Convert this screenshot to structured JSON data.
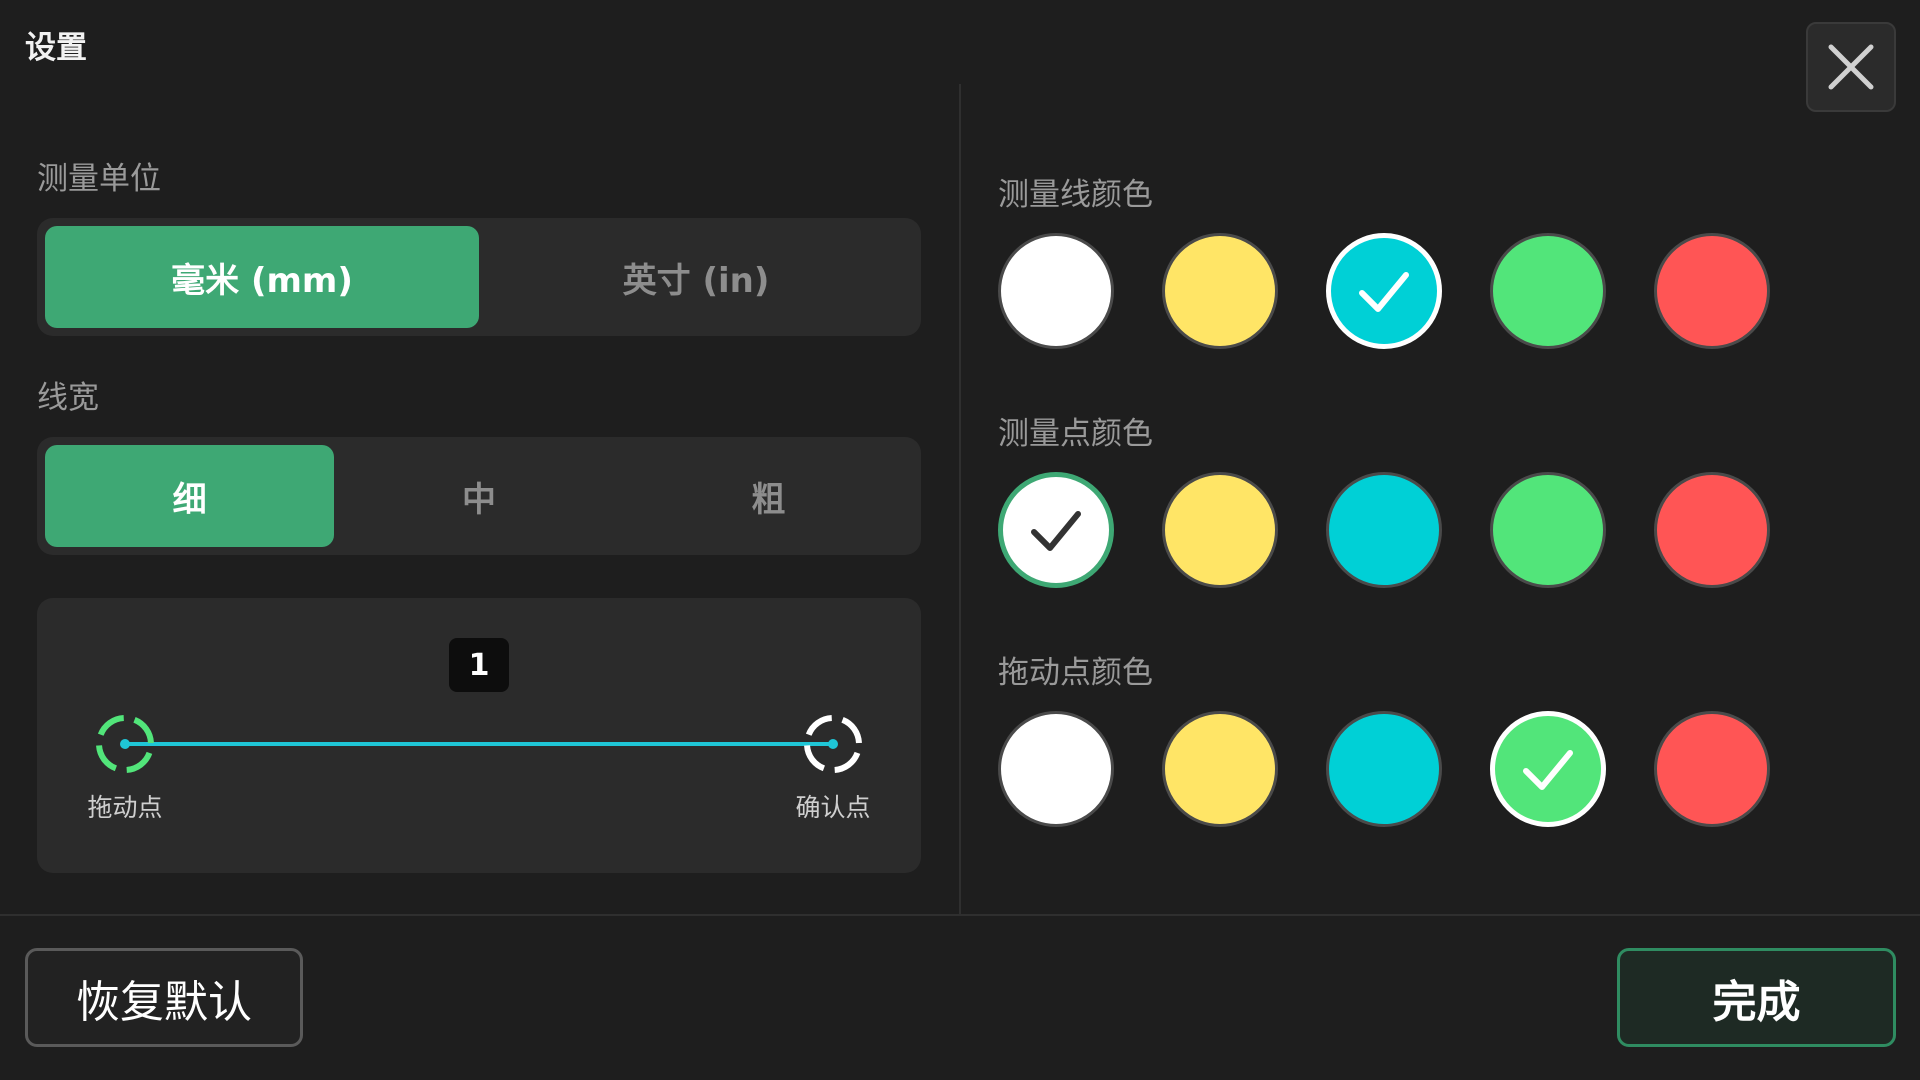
{
  "header": {
    "title": "设置",
    "close_icon": "close-icon"
  },
  "units": {
    "label": "测量单位",
    "options": [
      "毫米 (mm)",
      "英寸 (in)"
    ],
    "selected": "毫米 (mm)"
  },
  "line_width": {
    "label": "线宽",
    "options": [
      "细",
      "中",
      "粗"
    ],
    "selected": "细"
  },
  "preview": {
    "value": "1",
    "start_label": "拖动点",
    "end_label": "确认点"
  },
  "colors": {
    "palette": [
      "#ffffff",
      "#ffe566",
      "#00d0d6",
      "#52e57a",
      "#ff5555"
    ],
    "line_color": {
      "label": "测量线颜色",
      "selected": "#00d0d6"
    },
    "point_color": {
      "label": "测量点颜色",
      "selected": "#ffffff"
    },
    "drag_color": {
      "label": "拖动点颜色",
      "selected": "#52e57a"
    }
  },
  "footer": {
    "reset_label": "恢复默认",
    "done_label": "完成"
  },
  "accent": "#3ea874"
}
